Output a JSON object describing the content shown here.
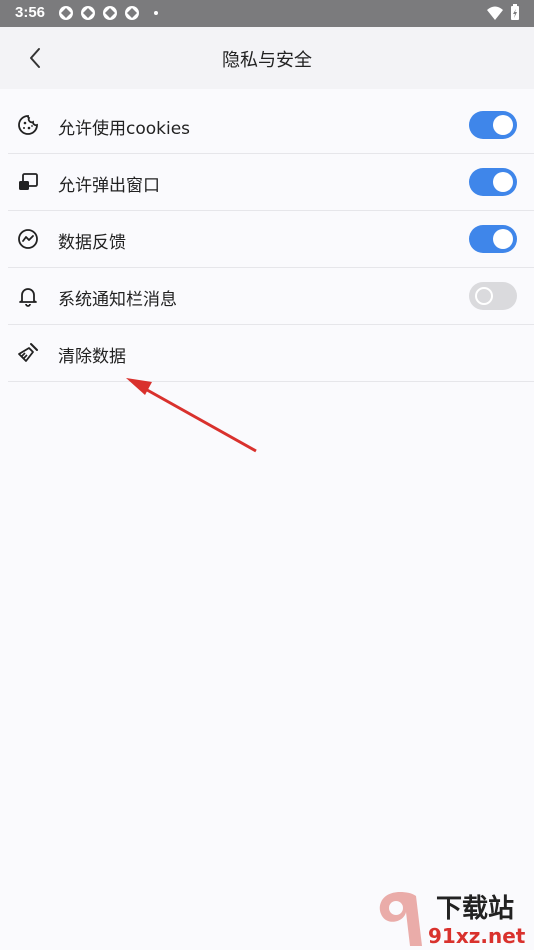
{
  "status_bar": {
    "time": "3:56"
  },
  "header": {
    "title": "隐私与安全"
  },
  "settings": [
    {
      "label": "允许使用cookies",
      "icon": "cookie-icon",
      "toggle": true
    },
    {
      "label": "允许弹出窗口",
      "icon": "popup-window-icon",
      "toggle": true
    },
    {
      "label": "数据反馈",
      "icon": "feedback-chart-icon",
      "toggle": true
    },
    {
      "label": "系统通知栏消息",
      "icon": "bell-icon",
      "toggle": false
    },
    {
      "label": "清除数据",
      "icon": "broom-icon"
    }
  ],
  "colors": {
    "toggle_on": "#3f86ea",
    "toggle_off": "#dadadd",
    "annotation_arrow": "#d9312d"
  },
  "watermark": {
    "cn": "下载站",
    "en": "91xz.net"
  }
}
